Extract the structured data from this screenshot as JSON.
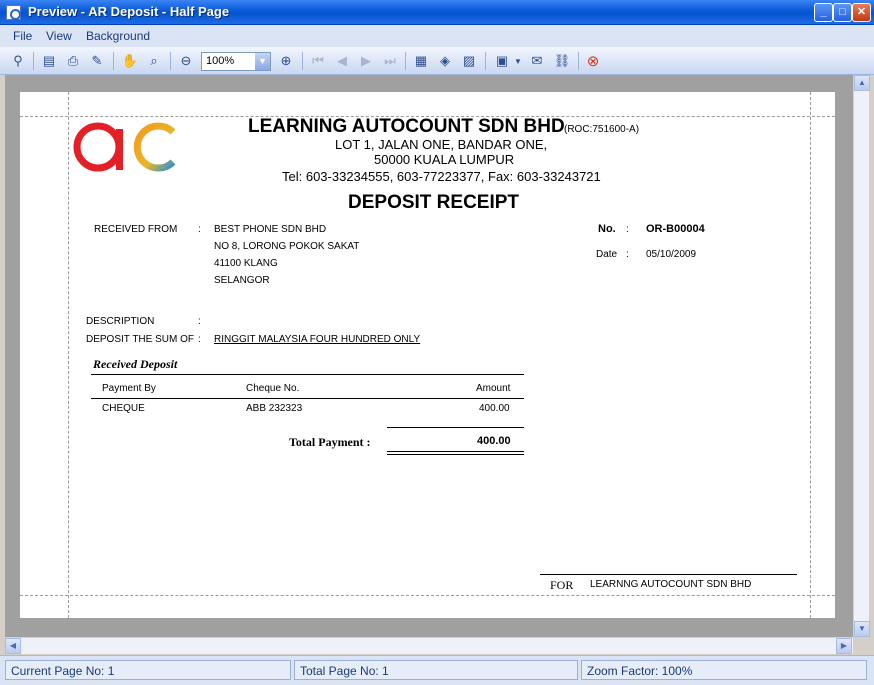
{
  "window": {
    "title": "Preview - AR Deposit - Half Page",
    "controls": [
      "minimize-icon",
      "maximize-icon",
      "close-icon"
    ]
  },
  "menu": [
    "File",
    "View",
    "Background"
  ],
  "toolbar": {
    "zoom_value": "100%",
    "icons": [
      "binoculars-icon",
      "print-setup-icon",
      "print-icon",
      "export-icon",
      "hand-icon",
      "magnifier-icon",
      "zoom-out-icon",
      "zoom-in-icon",
      "first-page-icon",
      "prev-page-icon",
      "next-page-icon",
      "last-page-icon",
      "multi-page-icon",
      "color-icon",
      "watermark-icon",
      "save-icon",
      "email-icon",
      "link-icon",
      "close-preview-icon"
    ]
  },
  "document": {
    "company_name": "LEARNING AUTOCOUNT SDN BHD",
    "roc": "(ROC:751600-A)",
    "address_line1": "LOT 1, JALAN ONE,  BANDAR ONE,",
    "address_line2": "50000 KUALA LUMPUR",
    "contact": "Tel:  603-33234555,  603-77223377,  Fax: 603-33243721",
    "doc_title": "DEPOSIT RECEIPT",
    "received_from_label": "RECEIVED FROM",
    "colon": ":",
    "customer_name": "BEST PHONE SDN BHD",
    "customer_addr1": "NO 8, LORONG POKOK SAKAT",
    "customer_addr2": "41100 KLANG",
    "customer_addr3": "SELANGOR",
    "no_label": "No.",
    "no_value": "OR-B00004",
    "date_label": "Date",
    "date_value": "05/10/2009",
    "description_label": "DESCRIPTION",
    "sum_label": "DEPOSIT THE SUM OF",
    "sum_words": "RINGGIT MALAYSIA FOUR HUNDRED ONLY",
    "section_title": "Received Deposit",
    "table_headers": [
      "Payment By",
      "Cheque No.",
      "Amount"
    ],
    "rows": [
      {
        "payment_by": "CHEQUE",
        "cheque_no": "ABB 232323",
        "amount": "400.00"
      }
    ],
    "total_label": "Total Payment :",
    "total_value": "400.00",
    "for_label": "FOR",
    "for_company": "LEARNNG AUTOCOUNT SDN BHD"
  },
  "status": {
    "current_page": "Current Page No: 1",
    "total_page": "Total Page No: 1",
    "zoom_factor": "Zoom Factor: 100%"
  },
  "colors": {
    "titlebar": "#0a58d8",
    "logo_red": "#e32026",
    "logo_orange": "#f39a1e",
    "logo_blue": "#2a8fd6"
  }
}
